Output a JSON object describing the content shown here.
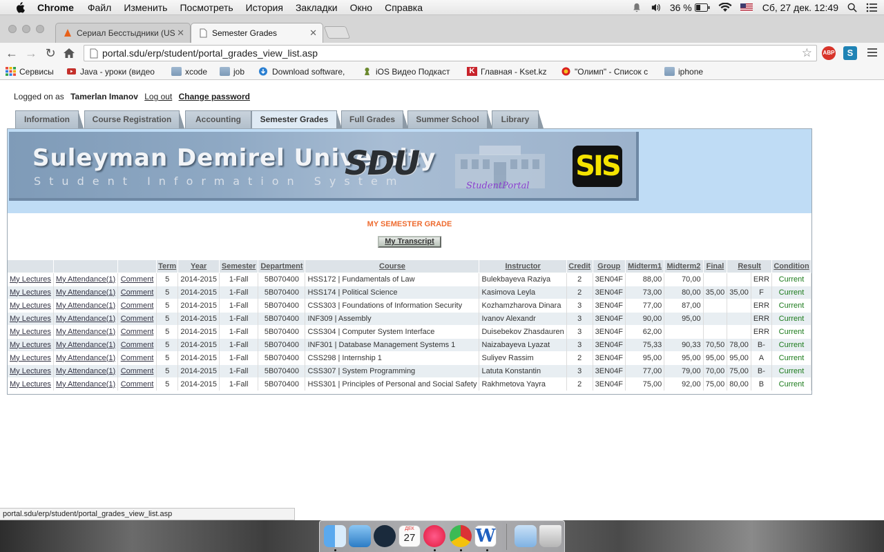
{
  "menubar": {
    "app": "Chrome",
    "items": [
      "Файл",
      "Изменить",
      "Посмотреть",
      "История",
      "Закладки",
      "Окно",
      "Справка"
    ],
    "battery": "36 %",
    "datetime": "Сб, 27 дек.  12:49"
  },
  "tabs": [
    {
      "title": "Сериал Бесстыдники (US"
    },
    {
      "title": "Semester Grades"
    }
  ],
  "address": {
    "url": "portal.sdu/erp/student/portal_grades_view_list.asp"
  },
  "extensions": {
    "adblock": "ABP",
    "s": "S"
  },
  "bookmarks": [
    {
      "label": "Сервисы"
    },
    {
      "label": "Java - уроки (видео"
    },
    {
      "label": "xcode"
    },
    {
      "label": "job"
    },
    {
      "label": "Download software, "
    },
    {
      "label": "iOS Видео Подкаст"
    },
    {
      "label": "Главная - Kset.kz"
    },
    {
      "label": "\"Олимп\" - Список с"
    },
    {
      "label": "iphone"
    }
  ],
  "page": {
    "logged_on_label": "Logged on as",
    "user": "Tamerlan Imanov",
    "logout": "Log out",
    "change_password": "Change password",
    "nav_tabs": [
      "Information",
      "Course Registration",
      "Accounting",
      "Semester Grades",
      "Full Grades",
      "Summer School",
      "Library"
    ],
    "banner": {
      "university": "Suleyman Demirel University",
      "subtitle": "Student Information System",
      "sdu_logo": "SDU",
      "portal_logo": "StudentPortal",
      "sis_logo": "SIS"
    },
    "section_title": "MY SEMESTER GRADE",
    "transcript_button": "My Transcript",
    "columns": [
      "",
      "",
      "",
      "Term",
      "Year",
      "Semester",
      "Department",
      "Course",
      "Instructor",
      "Credit",
      "Group",
      "Midterm1",
      "Midterm2",
      "Final",
      "Result",
      "",
      "Condition"
    ],
    "link_lectures": "My Lectures",
    "link_attendance": "My Attendance(1)",
    "link_comment": "Comment",
    "rows": [
      {
        "term": "5",
        "year": "2014-2015",
        "semester": "1-Fall",
        "department": "5B070400",
        "course": "HSS172 | Fundamentals of Law",
        "instructor": "Bulekbayeva Raziya",
        "credit": "2",
        "group": "3EN04F",
        "midterm1": "88,00",
        "midterm2": "70,00",
        "final": "",
        "result": "",
        "grade": "ERR",
        "condition": "Current"
      },
      {
        "term": "5",
        "year": "2014-2015",
        "semester": "1-Fall",
        "department": "5B070400",
        "course": "HSS174 | Political Science",
        "instructor": "Kasimova Leyla",
        "credit": "2",
        "group": "3EN04F",
        "midterm1": "73,00",
        "midterm2": "80,00",
        "final": "35,00",
        "result": "35,00",
        "grade": "F",
        "condition": "Current"
      },
      {
        "term": "5",
        "year": "2014-2015",
        "semester": "1-Fall",
        "department": "5B070400",
        "course": "CSS303 | Foundations of Information Security",
        "instructor": "Kozhamzharova Dinara",
        "credit": "3",
        "group": "3EN04F",
        "midterm1": "77,00",
        "midterm2": "87,00",
        "final": "",
        "result": "",
        "grade": "ERR",
        "condition": "Current"
      },
      {
        "term": "5",
        "year": "2014-2015",
        "semester": "1-Fall",
        "department": "5B070400",
        "course": "INF309 | Assembly",
        "instructor": "Ivanov Alexandr",
        "credit": "3",
        "group": "3EN04F",
        "midterm1": "90,00",
        "midterm2": "95,00",
        "final": "",
        "result": "",
        "grade": "ERR",
        "condition": "Current"
      },
      {
        "term": "5",
        "year": "2014-2015",
        "semester": "1-Fall",
        "department": "5B070400",
        "course": "CSS304 | Computer System Interface",
        "instructor": "Duisebekov Zhasdauren",
        "credit": "3",
        "group": "3EN04F",
        "midterm1": "62,00",
        "midterm2": "",
        "final": "",
        "result": "",
        "grade": "ERR",
        "condition": "Current"
      },
      {
        "term": "5",
        "year": "2014-2015",
        "semester": "1-Fall",
        "department": "5B070400",
        "course": "INF301 | Database Management Systems 1",
        "instructor": "Naizabayeva Lyazat",
        "credit": "3",
        "group": "3EN04F",
        "midterm1": "75,33",
        "midterm2": "90,33",
        "final": "70,50",
        "result": "78,00",
        "grade": "B-",
        "condition": "Current"
      },
      {
        "term": "5",
        "year": "2014-2015",
        "semester": "1-Fall",
        "department": "5B070400",
        "course": "CSS298 | Internship 1",
        "instructor": "Suliyev Rassim",
        "credit": "2",
        "group": "3EN04F",
        "midterm1": "95,00",
        "midterm2": "95,00",
        "final": "95,00",
        "result": "95,00",
        "grade": "A",
        "condition": "Current"
      },
      {
        "term": "5",
        "year": "2014-2015",
        "semester": "1-Fall",
        "department": "5B070400",
        "course": "CSS307 | System Programming",
        "instructor": "Latuta Konstantin",
        "credit": "3",
        "group": "3EN04F",
        "midterm1": "77,00",
        "midterm2": "79,00",
        "final": "70,00",
        "result": "75,00",
        "grade": "B-",
        "condition": "Current"
      },
      {
        "term": "5",
        "year": "2014-2015",
        "semester": "1-Fall",
        "department": "5B070400",
        "course": "HSS301 | Principles of Personal and Social Safety",
        "instructor": "Rakhmetova Yayra",
        "credit": "2",
        "group": "3EN04F",
        "midterm1": "75,00",
        "midterm2": "92,00",
        "final": "75,00",
        "result": "80,00",
        "grade": "B",
        "condition": "Current"
      }
    ]
  },
  "statusbar": {
    "text": "portal.sdu/erp/student/portal_grades_view_list.asp"
  },
  "dock": {
    "calendar_month": "ДЕК",
    "calendar_day": "27"
  }
}
